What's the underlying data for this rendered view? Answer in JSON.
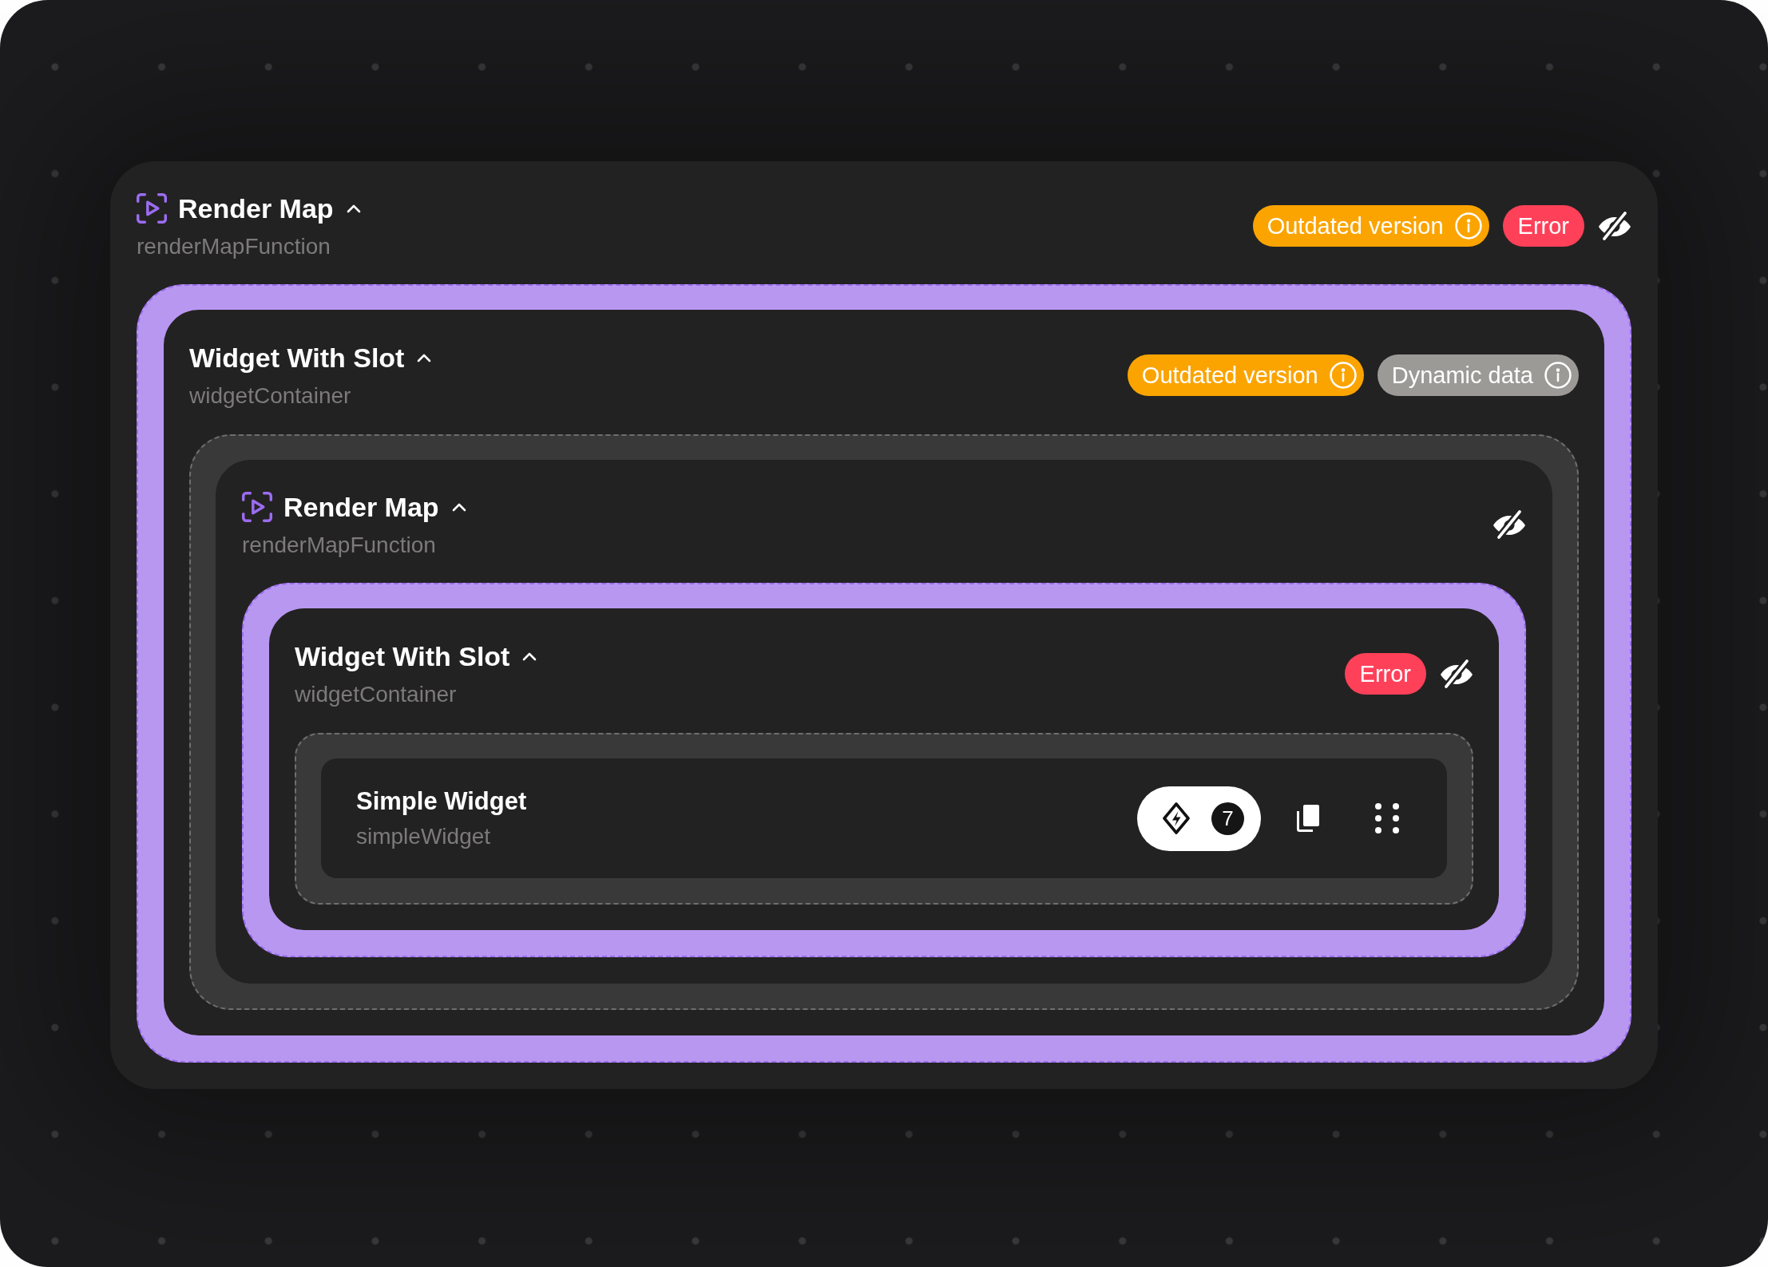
{
  "canvas": {
    "root": {
      "kind": "render_map",
      "title": "Render Map",
      "subtitle": "renderMapFunction",
      "expanded": true,
      "tags": [
        {
          "kind": "warning",
          "label": "Outdated version"
        },
        {
          "kind": "error",
          "label": "Error"
        }
      ],
      "hidden": true,
      "children": [
        {
          "kind": "widget_slot",
          "title": "Widget With Slot",
          "subtitle": "widgetContainer",
          "expanded": true,
          "tags": [
            {
              "kind": "warning",
              "label": "Outdated version"
            },
            {
              "kind": "dynamic",
              "label": "Dynamic data"
            }
          ],
          "children": [
            {
              "kind": "render_map",
              "title": "Render Map",
              "subtitle": "renderMapFunction",
              "expanded": true,
              "hidden": true,
              "children": [
                {
                  "kind": "widget_slot",
                  "title": "Widget With Slot",
                  "subtitle": "widgetContainer",
                  "expanded": true,
                  "tags": [
                    {
                      "kind": "error",
                      "label": "Error"
                    }
                  ],
                  "hidden": true,
                  "children": [
                    {
                      "kind": "widget",
                      "title": "Simple Widget",
                      "subtitle": "simpleWidget",
                      "count": "7"
                    }
                  ]
                }
              ]
            }
          ]
        }
      ]
    }
  }
}
